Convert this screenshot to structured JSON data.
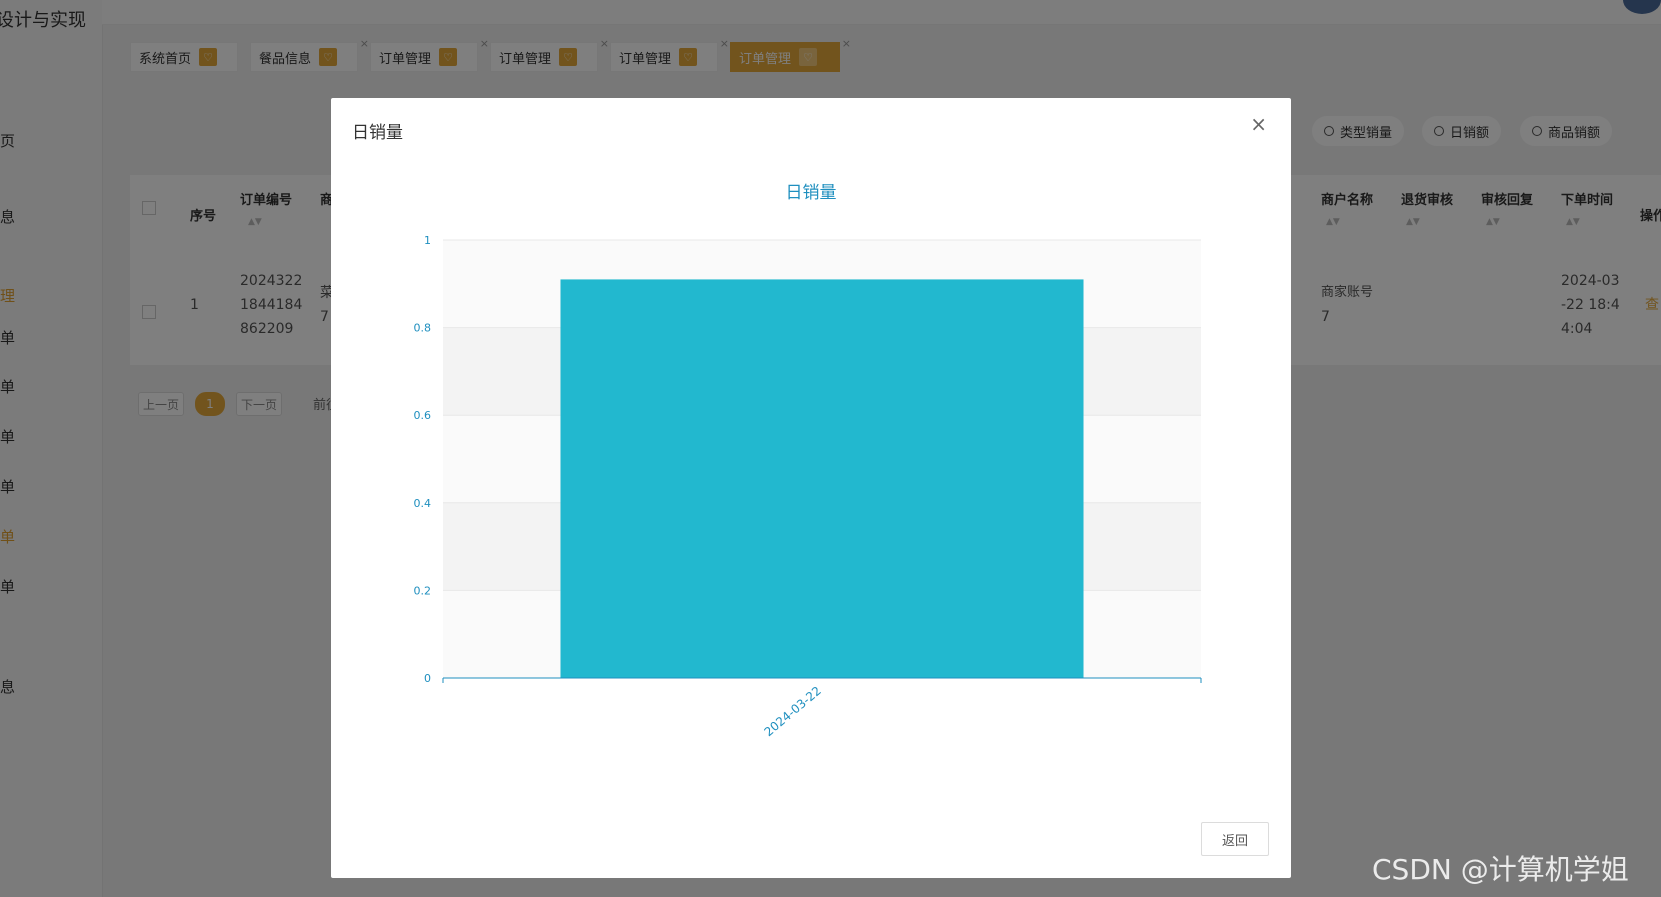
{
  "app": {
    "title": "设计与实现"
  },
  "sidebar": {
    "items": [
      "页",
      "息",
      "理",
      "单",
      "单",
      "单",
      "单",
      "单",
      "单",
      "息"
    ]
  },
  "tabs": [
    {
      "label": "系统首页"
    },
    {
      "label": "餐品信息"
    },
    {
      "label": "订单管理"
    },
    {
      "label": "订单管理"
    },
    {
      "label": "订单管理"
    },
    {
      "label": "订单管理"
    }
  ],
  "stats": {
    "btn1": "类型销量",
    "btn2": "日销额",
    "btn3": "商品销额"
  },
  "table": {
    "headers": {
      "index": "序号",
      "order_no": "订单编号",
      "col3": "商",
      "merchant": "商户名称",
      "return_review": "退货审核",
      "review_reply": "审核回复",
      "order_time": "下单时间",
      "actions": "操作"
    },
    "row": {
      "index": "1",
      "order_no_l1": "2024322",
      "order_no_l2": "1844184",
      "order_no_l3": "862209",
      "col3_l1": "菜",
      "col3_l2": "7",
      "merchant_l1": "商家账号",
      "merchant_l2": "7",
      "time_l1": "2024-03",
      "time_l2": "-22 18:4",
      "time_l3": "4:04",
      "action": "查"
    }
  },
  "pagination": {
    "prev": "上一页",
    "current": "1",
    "next": "下一页",
    "goto": "前往"
  },
  "modal": {
    "title": "日销量",
    "close": "×",
    "back_button": "返回"
  },
  "chart_data": {
    "type": "bar",
    "title": "日销量",
    "categories": [
      "2024-03-22"
    ],
    "values": [
      0.91
    ],
    "ylim": [
      0,
      1
    ],
    "yticks": [
      "0",
      "0.2",
      "0.4",
      "0.6",
      "0.8",
      "1"
    ],
    "bar_color": "#22b8cf",
    "axis_color": "#1f8fbf"
  },
  "watermark": "CSDN @计算机学姐"
}
